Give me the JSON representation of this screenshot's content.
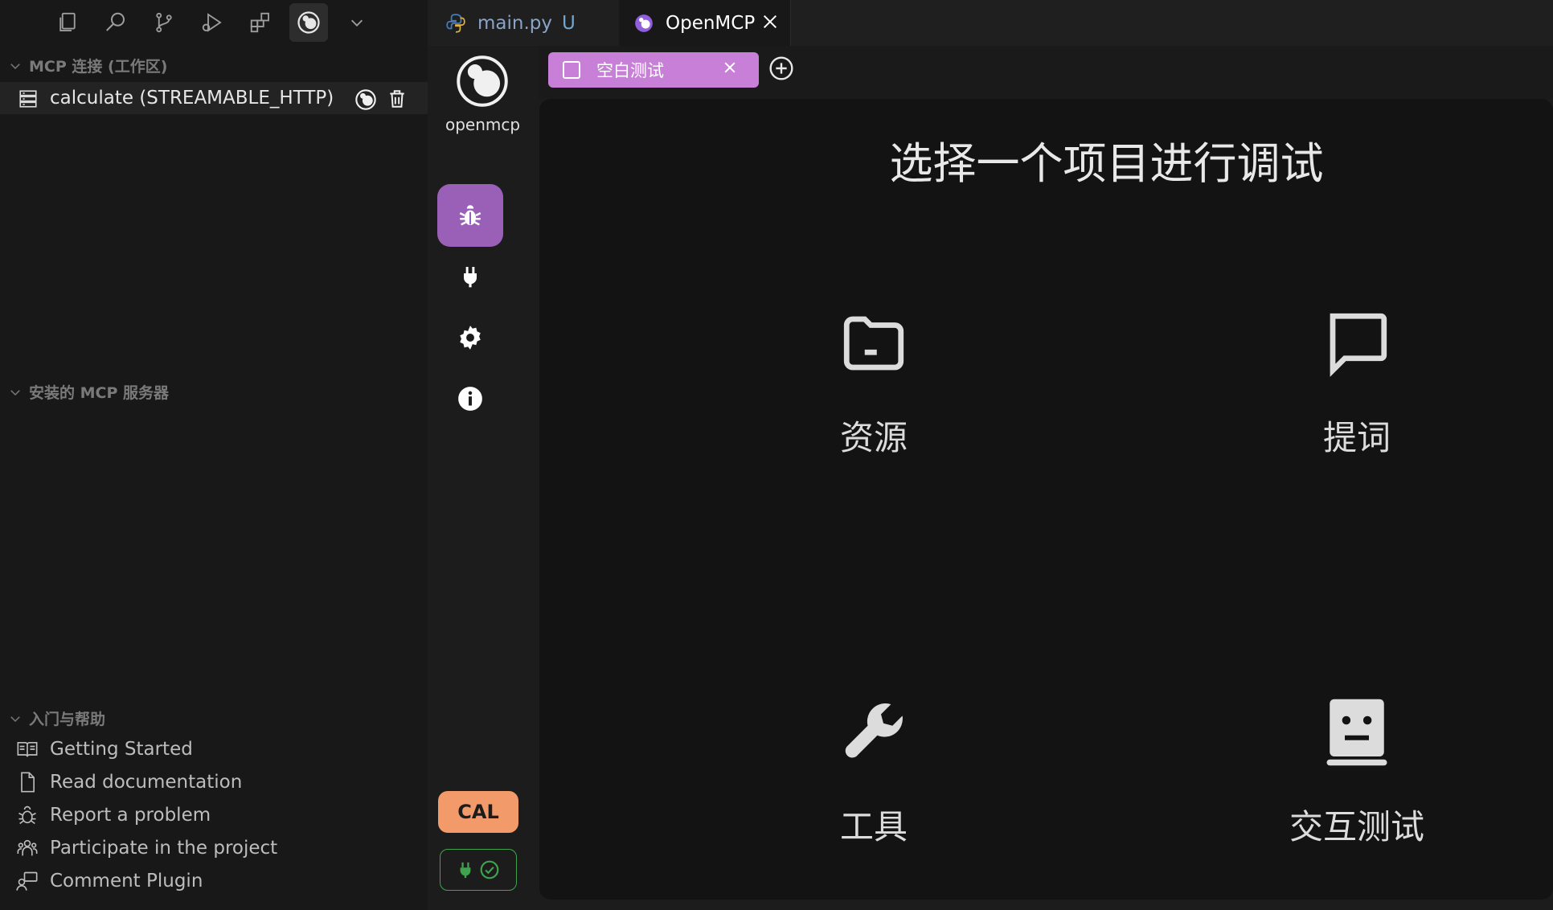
{
  "sidebar": {
    "sections": {
      "connections": "MCP 连接 (工作区)",
      "installed": "安装的 MCP 服务器",
      "help": "入门与帮助"
    },
    "connection": {
      "label": "calculate (STREAMABLE_HTTP)"
    },
    "help_items": [
      {
        "label": "Getting Started",
        "icon": "book-icon"
      },
      {
        "label": "Read documentation",
        "icon": "file-icon"
      },
      {
        "label": "Report a problem",
        "icon": "bug-icon"
      },
      {
        "label": "Participate in the project",
        "icon": "people-icon"
      },
      {
        "label": "Comment Plugin",
        "icon": "comment-person-icon"
      }
    ]
  },
  "editor_tabs": [
    {
      "label": "main.py",
      "badge": "U",
      "icon": "python-icon"
    },
    {
      "label": "OpenMCP",
      "icon": "openmcp-icon"
    }
  ],
  "webview": {
    "brand": "openmcp",
    "cal_label": "CAL",
    "sub_tab": {
      "label": "空白测试"
    },
    "title": "选择一个项目进行调试",
    "cards": [
      {
        "label": "资源",
        "icon": "folder-icon"
      },
      {
        "label": "提词",
        "icon": "message-icon"
      },
      {
        "label": "工具",
        "icon": "wrench-icon"
      },
      {
        "label": "交互测试",
        "icon": "robot-icon"
      }
    ]
  },
  "colors": {
    "accent_purple": "#9a5fb6",
    "sub_tab_pink": "#c77fd8",
    "cal_orange": "#f29a6a",
    "status_green": "#3fa34d"
  }
}
